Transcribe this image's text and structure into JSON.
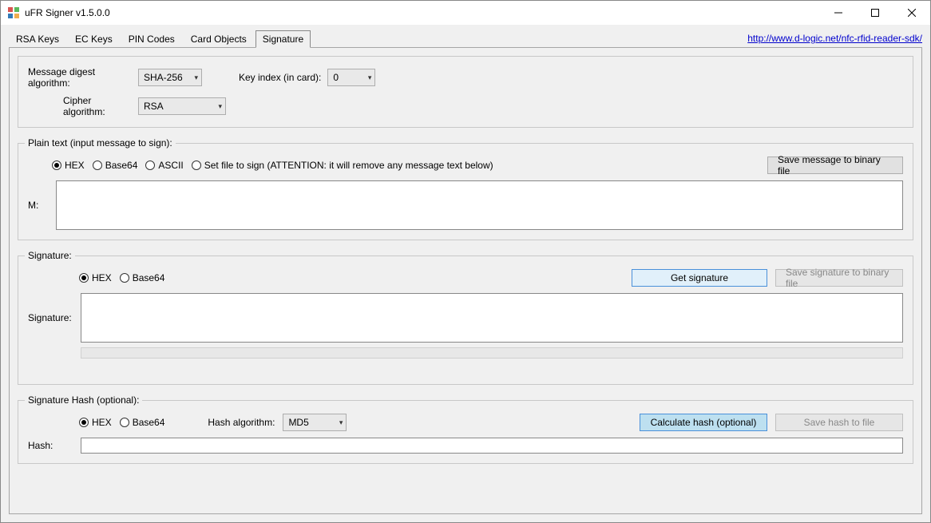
{
  "window": {
    "title": "uFR Signer v1.5.0.0"
  },
  "link": {
    "text": "http://www.d-logic.net/nfc-rfid-reader-sdk/"
  },
  "tabs": {
    "rsa": "RSA Keys",
    "ec": "EC Keys",
    "pin": "PIN Codes",
    "cardobj": "Card Objects",
    "sig": "Signature"
  },
  "topgroup": {
    "digest_label": "Message digest algorithm:",
    "digest_value": "SHA-256",
    "keyidx_label": "Key index (in card):",
    "keyidx_value": "0",
    "cipher_label": "Cipher algorithm:",
    "cipher_value": "RSA"
  },
  "plain": {
    "legend": "Plain text (input message to sign):",
    "radio_hex": "HEX",
    "radio_b64": "Base64",
    "radio_ascii": "ASCII",
    "radio_file": "Set file to sign (ATTENTION: it will remove any message text below)",
    "save_btn": "Save message to binary file",
    "m_label": "M:"
  },
  "sig": {
    "legend": "Signature:",
    "radio_hex": "HEX",
    "radio_b64": "Base64",
    "get_btn": "Get signature",
    "save_btn": "Save signature to binary file",
    "sig_label": "Signature:"
  },
  "hash": {
    "legend": "Signature Hash (optional):",
    "radio_hex": "HEX",
    "radio_b64": "Base64",
    "algo_label": "Hash algorithm:",
    "algo_value": "MD5",
    "calc_btn": "Calculate hash (optional)",
    "save_btn": "Save hash to file",
    "hash_label": "Hash:"
  }
}
